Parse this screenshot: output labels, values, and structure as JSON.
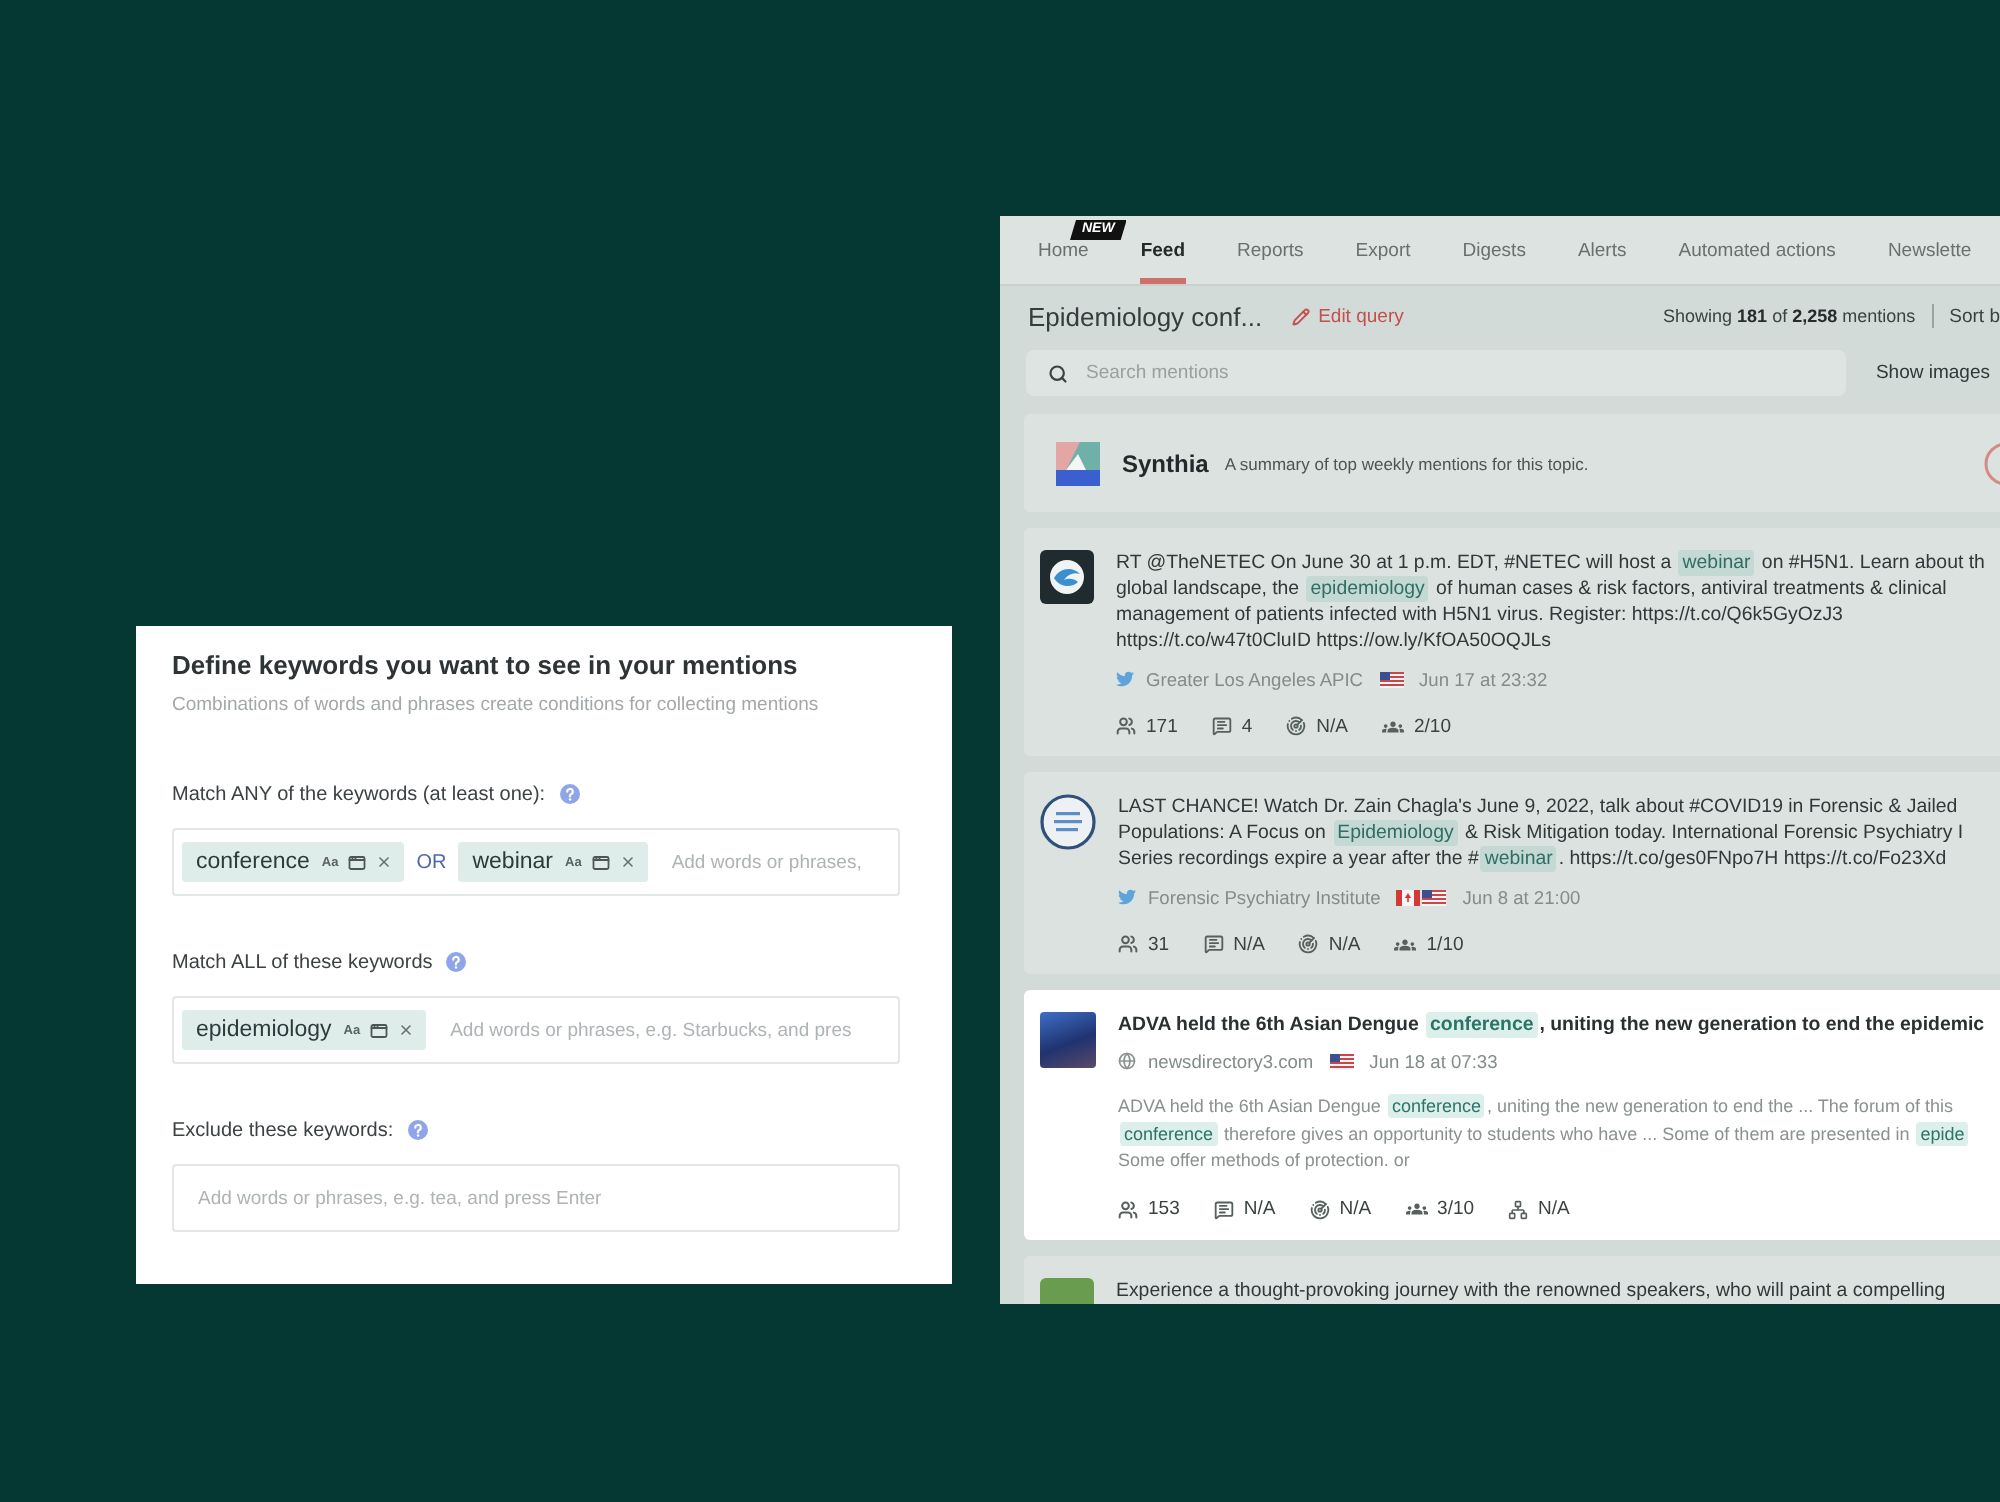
{
  "keywords_panel": {
    "title": "Define keywords you want to see in your mentions",
    "subtitle": "Combinations of words and phrases create conditions for collecting mentions",
    "sections": [
      {
        "label": "Match ANY of the keywords (at least one):",
        "items": [
          {
            "kind": "chip",
            "text": "conference",
            "case_label": "Aa"
          },
          {
            "kind": "operator",
            "text": "OR"
          },
          {
            "kind": "chip",
            "text": "webinar",
            "case_label": "Aa"
          }
        ],
        "placeholder": "Add words or phrases,"
      },
      {
        "label": "Match ALL of these keywords",
        "items": [
          {
            "kind": "chip",
            "text": "epidemiology",
            "case_label": "Aa"
          }
        ],
        "placeholder": "Add words or phrases, e.g. Starbucks, and pres"
      },
      {
        "label": "Exclude these keywords:",
        "placeholder": "Add words or phrases, e.g. tea, and press Enter"
      }
    ]
  },
  "feed_panel": {
    "tabs": [
      {
        "label": "Home",
        "selected": false,
        "badge": "NEW"
      },
      {
        "label": "Feed",
        "selected": true
      },
      {
        "label": "Reports",
        "selected": false
      },
      {
        "label": "Export",
        "selected": false
      },
      {
        "label": "Digests",
        "selected": false
      },
      {
        "label": "Alerts",
        "selected": false
      },
      {
        "label": "Automated actions",
        "selected": false
      },
      {
        "label": "Newslette",
        "selected": false
      }
    ],
    "query_title": "Epidemiology conf...",
    "edit_query": "Edit query",
    "count": "Showing **181** of **2,258** mentions",
    "sort": "Sort b",
    "search": {
      "placeholder": "Search mentions"
    },
    "show_images": "Show images",
    "synthia": {
      "name": "Synthia",
      "description": "A summary of top weekly mentions for this topic."
    },
    "mentions": [
      {
        "kind": "post",
        "highlighted": false,
        "avatar": {
          "kind": "logo"
        },
        "text": [
          [
            {
              "text": "RT @TheNETEC On June 30 at 1 p.m. EDT, #NETEC will host a ",
              "keyword": false
            },
            {
              "text": "webinar",
              "keyword": true
            },
            {
              "text": " on #H5N1. Learn about th",
              "keyword": false
            }
          ],
          [
            {
              "text": "global landscape, the ",
              "keyword": false
            },
            {
              "text": "epidemiology",
              "keyword": true
            },
            {
              "text": " of human cases & risk factors, antiviral treatments & clinical",
              "keyword": false
            }
          ],
          [
            {
              "text": "management of patients infected with H5N1 virus. Register: https://t.co/Q6k5GyOzJ3",
              "keyword": false
            }
          ],
          [
            {
              "text": "https://t.co/w47t0CluID https://ow.ly/KfOA50OQJLs",
              "keyword": false
            }
          ]
        ],
        "source": {
          "kind": "twitter",
          "name": "Greater Los Angeles APIC"
        },
        "flags": [
          {
            "kind": "us"
          }
        ],
        "date": "Jun 17 at 23:32",
        "stats": [
          {
            "kind": "audience",
            "value": "171"
          },
          {
            "kind": "comments",
            "value": "4"
          },
          {
            "kind": "reach",
            "value": "N/A"
          },
          {
            "kind": "influence",
            "value": "2/10"
          }
        ]
      },
      {
        "kind": "post",
        "highlighted": false,
        "avatar": {
          "kind": "round-logo"
        },
        "text": [
          [
            {
              "text": "LAST CHANCE! Watch Dr. Zain Chagla's June 9, 2022, talk about #COVID19 in Forensic & Jailed",
              "keyword": false
            }
          ],
          [
            {
              "text": "Populations: A Focus on ",
              "keyword": false
            },
            {
              "text": "Epidemiology",
              "keyword": true
            },
            {
              "text": " & Risk Mitigation today. International Forensic Psychiatry I",
              "keyword": false
            }
          ],
          [
            {
              "text": "Series recordings expire a year after the #",
              "keyword": false
            },
            {
              "text": "webinar",
              "keyword": true
            },
            {
              "text": ". https://t.co/ges0FNpo7H https://t.co/Fo23Xd",
              "keyword": false
            }
          ]
        ],
        "source": {
          "kind": "twitter",
          "name": "Forensic Psychiatry Institute"
        },
        "flags": [
          {
            "kind": "ca"
          },
          {
            "kind": "us"
          }
        ],
        "date": "Jun 8 at 21:00",
        "stats": [
          {
            "kind": "audience",
            "value": "31"
          },
          {
            "kind": "comments",
            "value": "N/A"
          },
          {
            "kind": "reach",
            "value": "N/A"
          },
          {
            "kind": "influence",
            "value": "1/10"
          }
        ]
      },
      {
        "kind": "article",
        "highlighted": true,
        "avatar": {
          "kind": "photo"
        },
        "text": [
          [
            {
              "text": "ADVA held the 6th Asian Dengue ",
              "keyword": false
            },
            {
              "text": "conference",
              "keyword": true
            },
            {
              "text": ", uniting the new generation to end the epidemic",
              "keyword": false
            }
          ]
        ],
        "source": {
          "kind": "web",
          "name": "newsdirectory3.com"
        },
        "flags": [
          {
            "kind": "us"
          }
        ],
        "date": "Jun 18 at 07:33",
        "snippet": [
          [
            {
              "text": "ADVA held the 6th Asian Dengue ",
              "keyword": false
            },
            {
              "text": "conference",
              "keyword": true
            },
            {
              "text": ", uniting the new generation to end the ... The forum of this",
              "keyword": false
            }
          ],
          [
            {
              "text": "conference",
              "keyword": true
            },
            {
              "text": " therefore gives an opportunity to students who have ... Some of them are presented in ",
              "keyword": false
            },
            {
              "text": "epide",
              "keyword": true
            }
          ],
          [
            {
              "text": "Some offer methods of protection. or",
              "keyword": false
            }
          ]
        ],
        "stats": [
          {
            "kind": "audience",
            "value": "153"
          },
          {
            "kind": "comments",
            "value": "N/A"
          },
          {
            "kind": "reach",
            "value": "N/A"
          },
          {
            "kind": "influence",
            "value": "3/10"
          },
          {
            "kind": "shares",
            "value": "N/A"
          }
        ]
      },
      {
        "kind": "post",
        "highlighted": false,
        "avatar": {
          "kind": "tile"
        },
        "text": [
          [
            {
              "text": "Experience a thought-provoking journey with the renowned speakers, who will paint a compelling",
              "keyword": false
            }
          ]
        ]
      }
    ]
  }
}
